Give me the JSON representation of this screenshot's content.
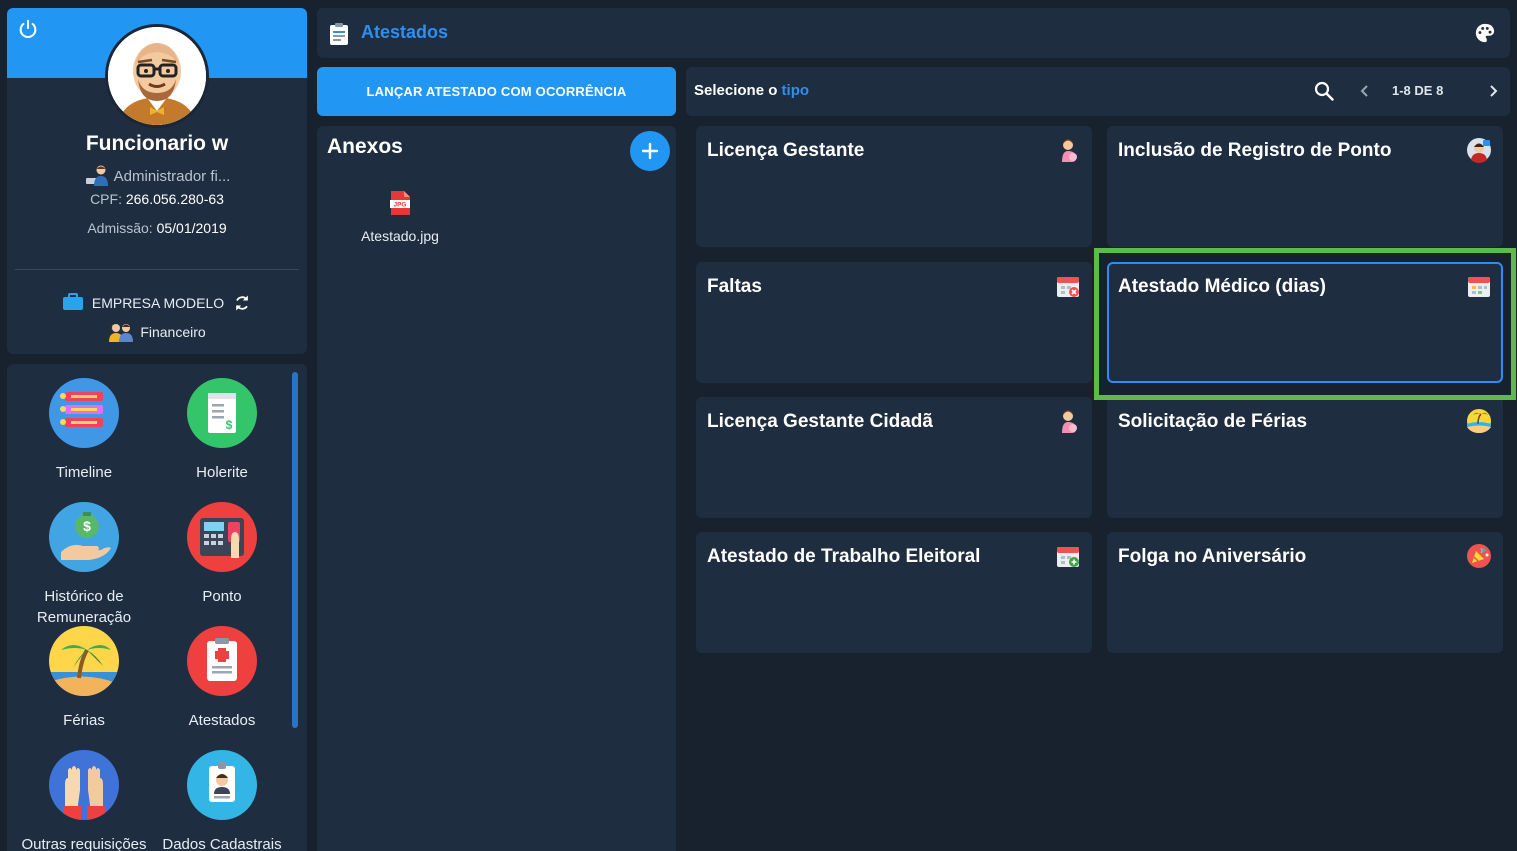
{
  "profile": {
    "name": "Funcionario w",
    "role": "Administrador fi...",
    "cpf_label": "CPF:",
    "cpf_value": "266.056.280-63",
    "admission_label": "Admissão:",
    "admission_value": "05/01/2019",
    "company": "EMPRESA MODELO",
    "department": "Financeiro"
  },
  "menu": {
    "items": [
      {
        "label": "Timeline",
        "icon": "timeline-icon"
      },
      {
        "label": "Holerite",
        "icon": "payslip-icon"
      },
      {
        "label": "Histórico de Remuneração",
        "icon": "money-hand-icon"
      },
      {
        "label": "Ponto",
        "icon": "time-clock-icon"
      },
      {
        "label": "Férias",
        "icon": "beach-icon"
      },
      {
        "label": "Atestados",
        "icon": "medical-clipboard-icon"
      },
      {
        "label": "Outras requisições",
        "icon": "raised-hands-icon"
      },
      {
        "label": "Dados Cadastrais",
        "icon": "id-badge-icon"
      }
    ]
  },
  "header": {
    "title": "Atestados",
    "icon": "clipboard-icon"
  },
  "actions": {
    "launch_label": "LANÇAR ATESTADO COM OCORRÊNCIA"
  },
  "attachments": {
    "title": "Anexos",
    "files": [
      {
        "name": "Atestado.jpg",
        "icon": "jpg-file-icon"
      }
    ]
  },
  "type_selector": {
    "label_prefix": "Selecione o",
    "label_accent": "tipo",
    "pagination": "1-8 DE 8"
  },
  "types": [
    {
      "title": "Licença Gestante",
      "icon": "pregnant-woman-icon"
    },
    {
      "title": "Inclusão de Registro de Ponto",
      "icon": "worker-avatar-icon"
    },
    {
      "title": "Faltas",
      "icon": "calendar-x-icon"
    },
    {
      "title": "Atestado Médico (dias)",
      "icon": "calendar-icon",
      "selected": true
    },
    {
      "title": "Licença Gestante Cidadã",
      "icon": "pregnant-woman-icon"
    },
    {
      "title": "Solicitação de Férias",
      "icon": "beach-ball-icon"
    },
    {
      "title": "Atestado de Trabalho Eleitoral",
      "icon": "calendar-plus-icon"
    },
    {
      "title": "Folga no Aniversário",
      "icon": "party-icon"
    }
  ],
  "colors": {
    "background": "#18222f",
    "panel": "#1f2d40",
    "accent": "#2196f3",
    "accent_text": "#2e8ff0",
    "selection_highlight": "#5cbb4a"
  }
}
